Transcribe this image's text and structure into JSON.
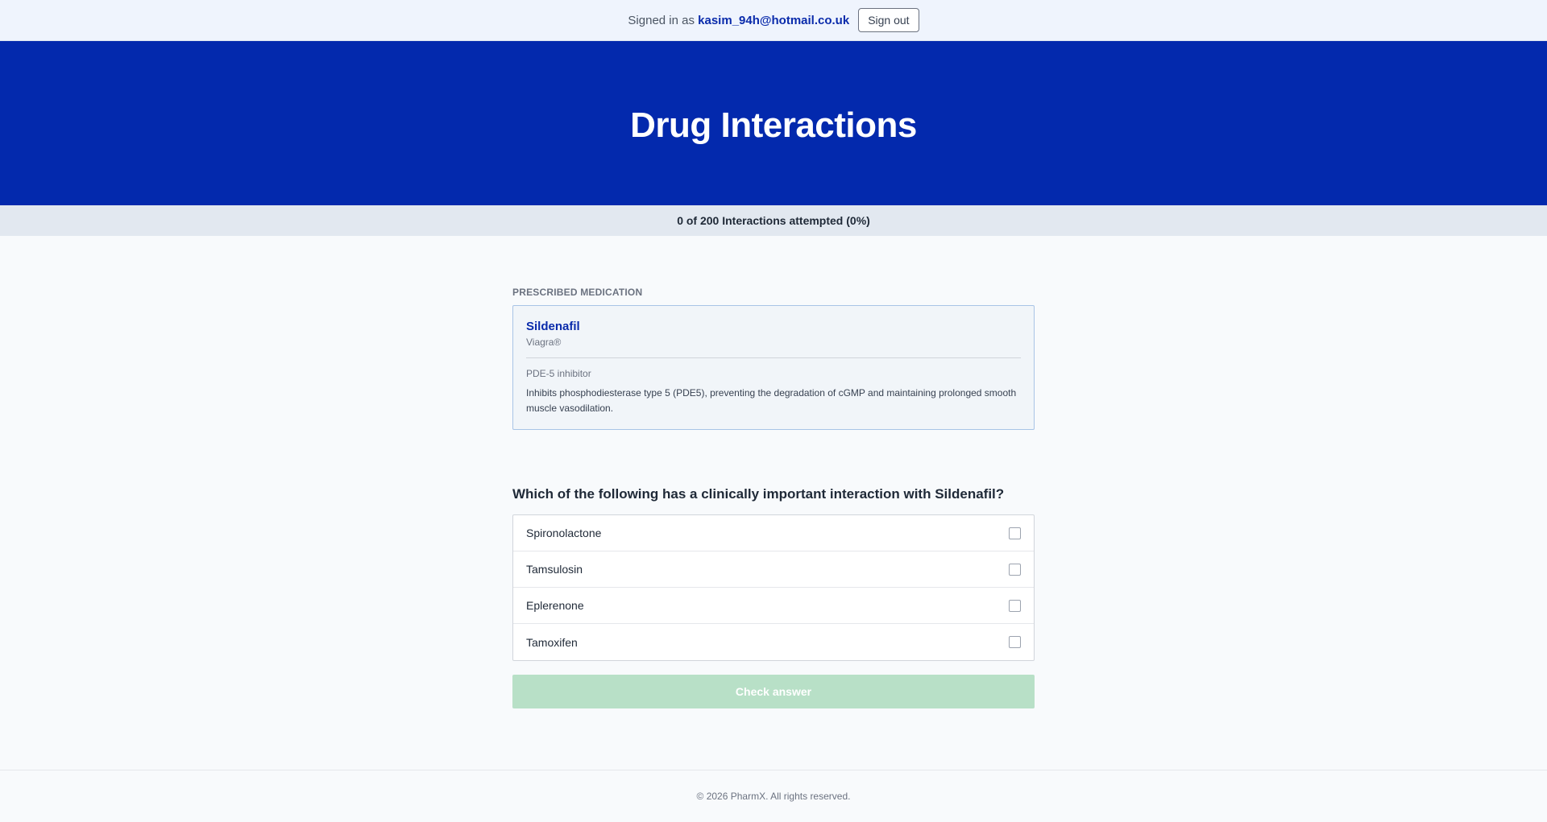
{
  "topbar": {
    "signed_in_prefix": "Signed in as",
    "email": "kasim_94h@hotmail.co.uk",
    "sign_out_label": "Sign out"
  },
  "hero": {
    "title": "Drug Interactions"
  },
  "progress": {
    "text": "0 of 200 Interactions attempted (0%)",
    "attempted": 0,
    "total": 200,
    "percent": 0
  },
  "medication": {
    "section_label": "PRESCRIBED MEDICATION",
    "name": "Sildenafil",
    "brand": "Viagra®",
    "drug_class": "PDE-5 inhibitor",
    "mechanism": "Inhibits phosphodiesterase type 5 (PDE5), preventing the degradation of cGMP and maintaining prolonged smooth muscle vasodilation."
  },
  "question": {
    "text": "Which of the following has a clinically important interaction with Sildenafil?",
    "options": [
      {
        "label": "Spironolactone",
        "checked": false
      },
      {
        "label": "Tamsulosin",
        "checked": false
      },
      {
        "label": "Eplerenone",
        "checked": false
      },
      {
        "label": "Tamoxifen",
        "checked": false
      }
    ],
    "submit_label": "Check answer",
    "submit_enabled": false
  },
  "footer": {
    "text": "© 2026 PharmX. All rights reserved."
  },
  "colors": {
    "brand_blue": "#0329ad",
    "link_blue": "#0a2bab",
    "disabled_green": "#b8e0c7"
  }
}
